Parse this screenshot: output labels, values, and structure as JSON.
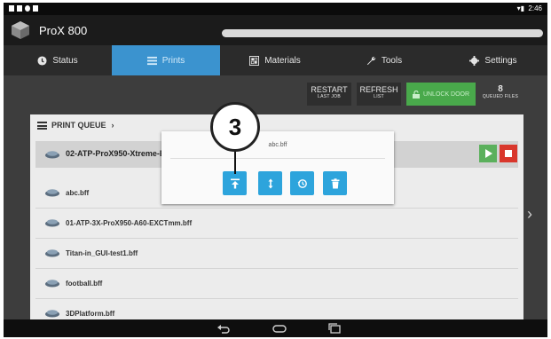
{
  "status_bar": {
    "time": "2:46"
  },
  "app": {
    "title": "ProX 800"
  },
  "tabs": [
    {
      "label": "Status",
      "icon": "clock-icon",
      "active": false
    },
    {
      "label": "Prints",
      "icon": "list-icon",
      "active": true
    },
    {
      "label": "Materials",
      "icon": "materials-icon",
      "active": false
    },
    {
      "label": "Tools",
      "icon": "wrench-icon",
      "active": false
    },
    {
      "label": "Settings",
      "icon": "gear-icon",
      "active": false
    }
  ],
  "actions": {
    "restart": {
      "line1": "RESTART",
      "line2": "LAST JOB"
    },
    "refresh": {
      "line1": "REFRESH",
      "line2": "LIST"
    },
    "unlock": {
      "label": "UNLOCK DOOR"
    },
    "queued": {
      "count": "8",
      "label": "QUEUED FILES"
    }
  },
  "queue": {
    "header": "PRINT QUEUE",
    "active_job": "02-ATP-ProX950-Xtreme-EXC",
    "files": [
      "abc.bff",
      "01-ATP-3X-ProX950-A60-EXCTmm.bff",
      "Titan-in_GUI-test1.bff",
      "football.bff",
      "3DPlatform.bff"
    ]
  },
  "popup": {
    "title": "abc.bff",
    "buttons": [
      "move-to-top-icon",
      "reorder-icon",
      "history-icon",
      "trash-icon"
    ]
  },
  "callout": {
    "number": "3"
  },
  "colors": {
    "accent": "#3b93cf",
    "popup_button": "#2da4dc",
    "unlock": "#49a94b",
    "play": "#5bb05c",
    "stop": "#d9372c"
  }
}
